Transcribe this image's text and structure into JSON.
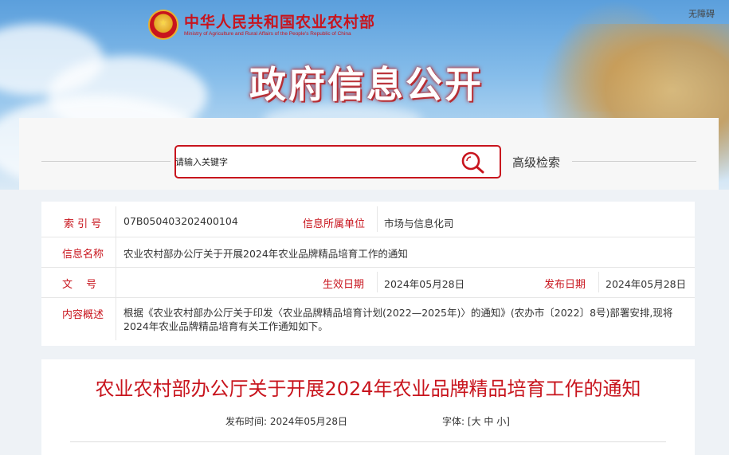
{
  "header": {
    "ministry_cn": "中华人民共和国农业农村部",
    "ministry_en": "Ministry of Agriculture and Rural Affairs of the People's Republic of China",
    "barrier_free": "无障碍",
    "section_title": "政府信息公开"
  },
  "search": {
    "placeholder": "请输入关键字",
    "advanced_label": "高级检索"
  },
  "info": {
    "index_label": "索 引 号",
    "index_value": "07B050403202400104",
    "unit_label": "信息所属单位",
    "unit_value": "市场与信息化司",
    "name_label": "信息名称",
    "name_value": "农业农村部办公厅关于开展2024年农业品牌精品培育工作的通知",
    "doc_no_label": "文　 号",
    "effective_label": "生效日期",
    "effective_value": "2024年05月28日",
    "publish_label": "发布日期",
    "publish_value": "2024年05月28日",
    "summary_label": "内容概述",
    "summary_line1": "根据《农业农村部办公厅关于印发〈农业品牌精品培育计划(2022—2025年)〉的通知》(农办市〔2022〕8号)部署安排,现将",
    "summary_line2": "2024年农业品牌精品培育有关工作通知如下。"
  },
  "article": {
    "title": "农业农村部办公厅关于开展2024年农业品牌精品培育工作的通知",
    "publish_time_label": "发布时间:",
    "publish_time_value": "2024年05月28日",
    "font_label": "字体:",
    "font_open": "[",
    "font_large": "大",
    "font_medium": "中",
    "font_small": "小",
    "font_close": "]"
  },
  "colors": {
    "accent_red": "#c8141d",
    "sky_blue": "#86bdea"
  }
}
